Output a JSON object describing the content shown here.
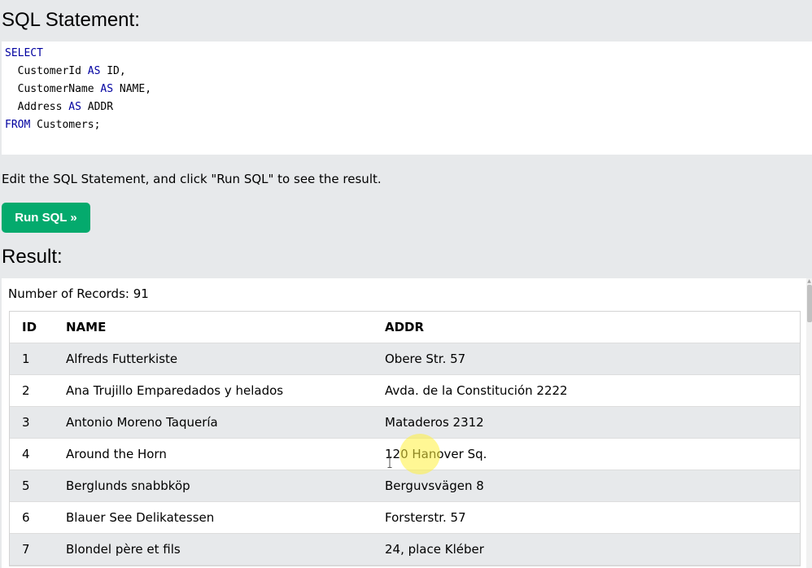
{
  "sql_section": {
    "heading": "SQL Statement:",
    "code": {
      "kw_select": "SELECT",
      "l1_col": "  CustomerId ",
      "l1_as": "AS",
      "l1_alias": " ID,",
      "l2_col": "  CustomerName ",
      "l2_as": "AS",
      "l2_alias": " NAME,",
      "l3_col": "  Address ",
      "l3_as": "AS",
      "l3_alias": " ADDR",
      "kw_from": "FROM",
      "from_rest": " Customers;"
    }
  },
  "instructions": "Edit the SQL Statement, and click \"Run SQL\" to see the result.",
  "run_button_label": "Run SQL »",
  "result_section": {
    "heading": "Result:",
    "records_label": "Number of Records: 91",
    "columns": [
      "ID",
      "NAME",
      "ADDR"
    ],
    "rows": [
      [
        "1",
        "Alfreds Futterkiste",
        "Obere Str. 57"
      ],
      [
        "2",
        "Ana Trujillo Emparedados y helados",
        "Avda. de la Constitución 2222"
      ],
      [
        "3",
        "Antonio Moreno Taquería",
        "Mataderos 2312"
      ],
      [
        "4",
        "Around the Horn",
        "120 Hanover Sq."
      ],
      [
        "5",
        "Berglunds snabbköp",
        "Berguvsvägen 8"
      ],
      [
        "6",
        "Blauer See Delikatessen",
        "Forsterstr. 57"
      ],
      [
        "7",
        "Blondel père et fils",
        "24, place Kléber"
      ]
    ]
  },
  "colors": {
    "page_background": "#e7e9eb",
    "run_button": "#04aa6d",
    "sql_keyword": "#0000a0",
    "cursor_highlight": "#fff03c"
  },
  "icons": {
    "text_cursor": "text-cursor-icon",
    "scroll_up": "chevron-up-icon"
  }
}
